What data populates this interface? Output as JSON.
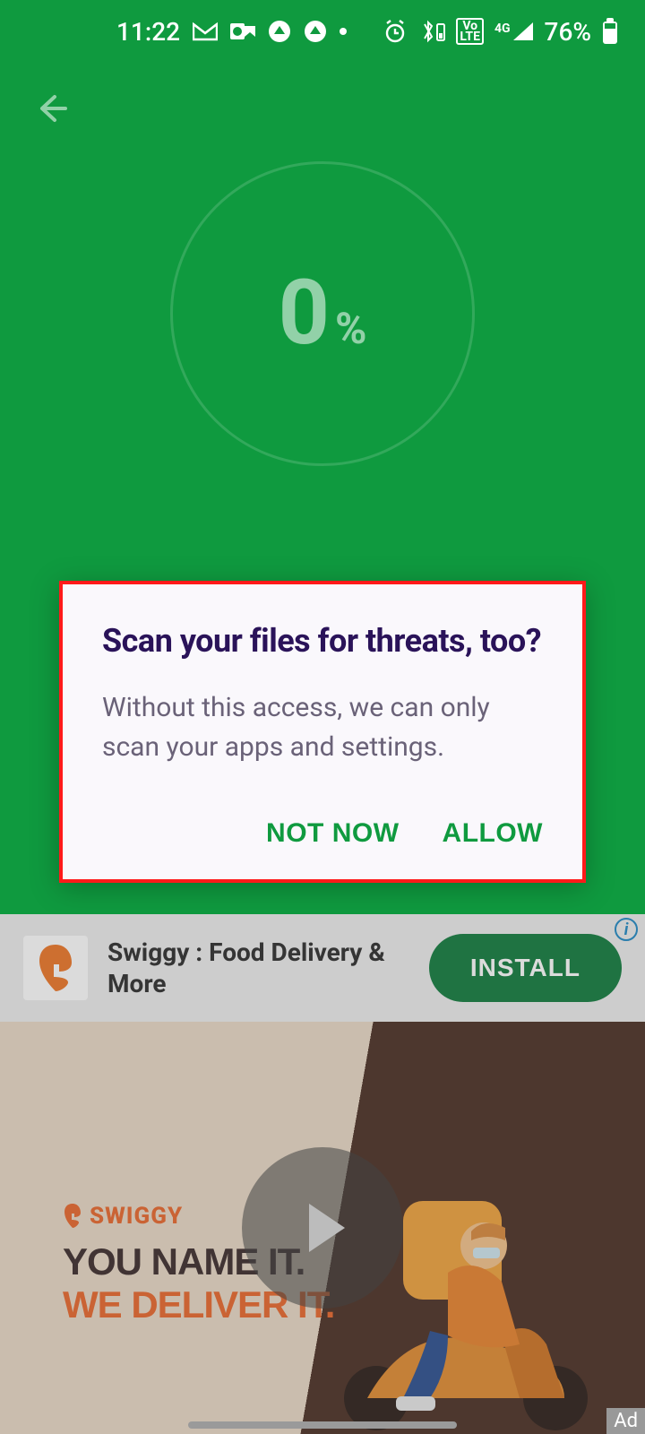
{
  "status": {
    "time": "11:22",
    "battery_pct": "76%",
    "lte_top": "Vo",
    "lte_bot": "LTE",
    "net": "4G"
  },
  "scan": {
    "value": "0",
    "unit": "%"
  },
  "dialog": {
    "title": "Scan your files for threats, too?",
    "body": "Without this access, we can only scan your apps and settings.",
    "not_now": "NOT NOW",
    "allow": "ALLOW"
  },
  "ad": {
    "title": "Swiggy : Food Delivery & More",
    "install": "INSTALL",
    "brand": "SWIGGY",
    "line1": "YOU NAME IT.",
    "line2": "WE DELIVER IT.",
    "badge": "Ad",
    "info": "i"
  }
}
